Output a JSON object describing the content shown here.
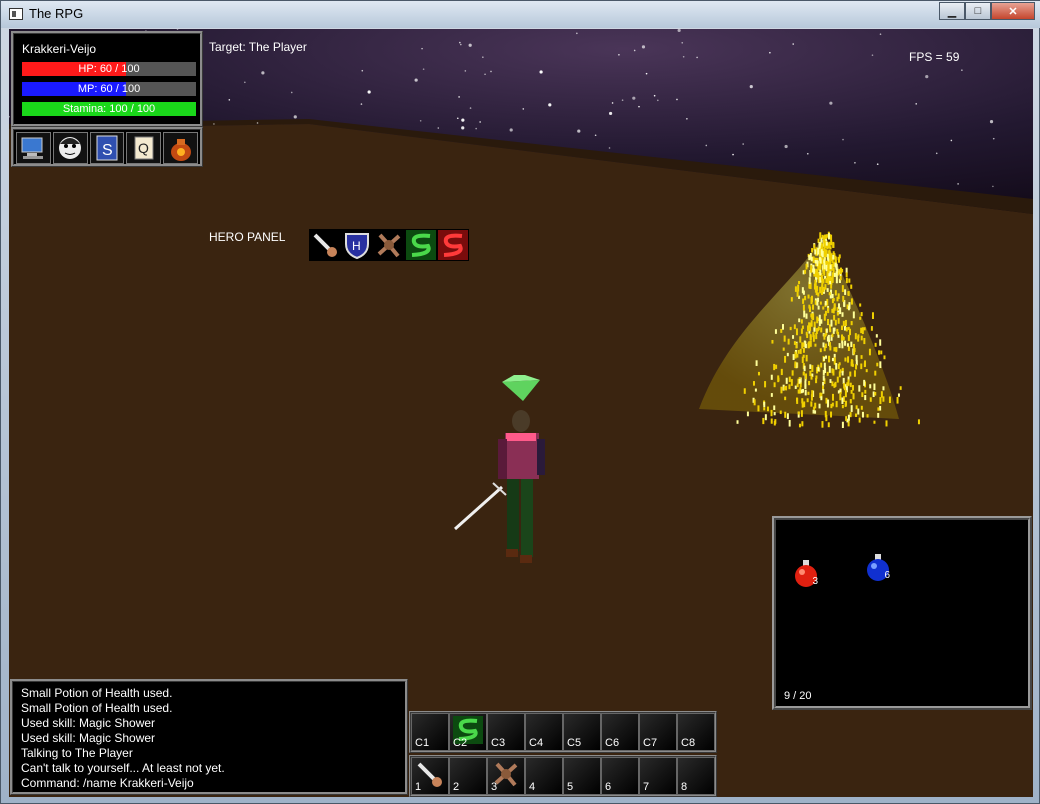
{
  "window": {
    "title": "The RPG"
  },
  "hud": {
    "player_name": "Krakkeri-Veijo",
    "hp": {
      "label": "HP: 60 / 100",
      "current": 60,
      "max": 100,
      "color": "#ff1a1a"
    },
    "mp": {
      "label": "MP: 60 / 100",
      "current": 60,
      "max": 100,
      "color": "#1a1aff"
    },
    "stamina": {
      "label": "Stamina: 100 / 100",
      "current": 100,
      "max": 100,
      "color": "#1ad81a"
    },
    "target": "Target: The Player",
    "fps": "FPS = 59",
    "menu_icons": [
      "computer-icon",
      "character-face-icon",
      "spellbook-icon",
      "quest-scroll-icon",
      "loot-bag-icon"
    ]
  },
  "hero_panel": {
    "label": "HERO PANEL",
    "icons": [
      "sword-icon",
      "shield-icon",
      "claw-icon",
      "green-serpent-icon",
      "red-serpent-icon"
    ]
  },
  "inventory": {
    "count": "9 / 20",
    "items": [
      {
        "name": "red-potion-icon",
        "qty": "3",
        "color": "#e02010"
      },
      {
        "name": "blue-potion-icon",
        "qty": "6",
        "color": "#1030d0"
      }
    ]
  },
  "chat": {
    "lines": [
      "Small Potion of Health used.",
      "Small Potion of Health used.",
      "Used skill: Magic Shower",
      "Used skill: Magic Shower",
      "Talking to The Player",
      "Can't talk to yourself... At least not yet.",
      "Command: /name Krakkeri-Veijo"
    ]
  },
  "actionbars": {
    "top": [
      {
        "key": "C1",
        "icon": ""
      },
      {
        "key": "C2",
        "icon": "green-serpent-icon"
      },
      {
        "key": "C3",
        "icon": ""
      },
      {
        "key": "C4",
        "icon": ""
      },
      {
        "key": "C5",
        "icon": ""
      },
      {
        "key": "C6",
        "icon": ""
      },
      {
        "key": "C7",
        "icon": ""
      },
      {
        "key": "C8",
        "icon": ""
      }
    ],
    "bottom": [
      {
        "key": "1",
        "icon": "sword-icon"
      },
      {
        "key": "2",
        "icon": ""
      },
      {
        "key": "3",
        "icon": "claw-icon"
      },
      {
        "key": "4",
        "icon": ""
      },
      {
        "key": "5",
        "icon": ""
      },
      {
        "key": "6",
        "icon": ""
      },
      {
        "key": "7",
        "icon": ""
      },
      {
        "key": "8",
        "icon": ""
      }
    ]
  }
}
